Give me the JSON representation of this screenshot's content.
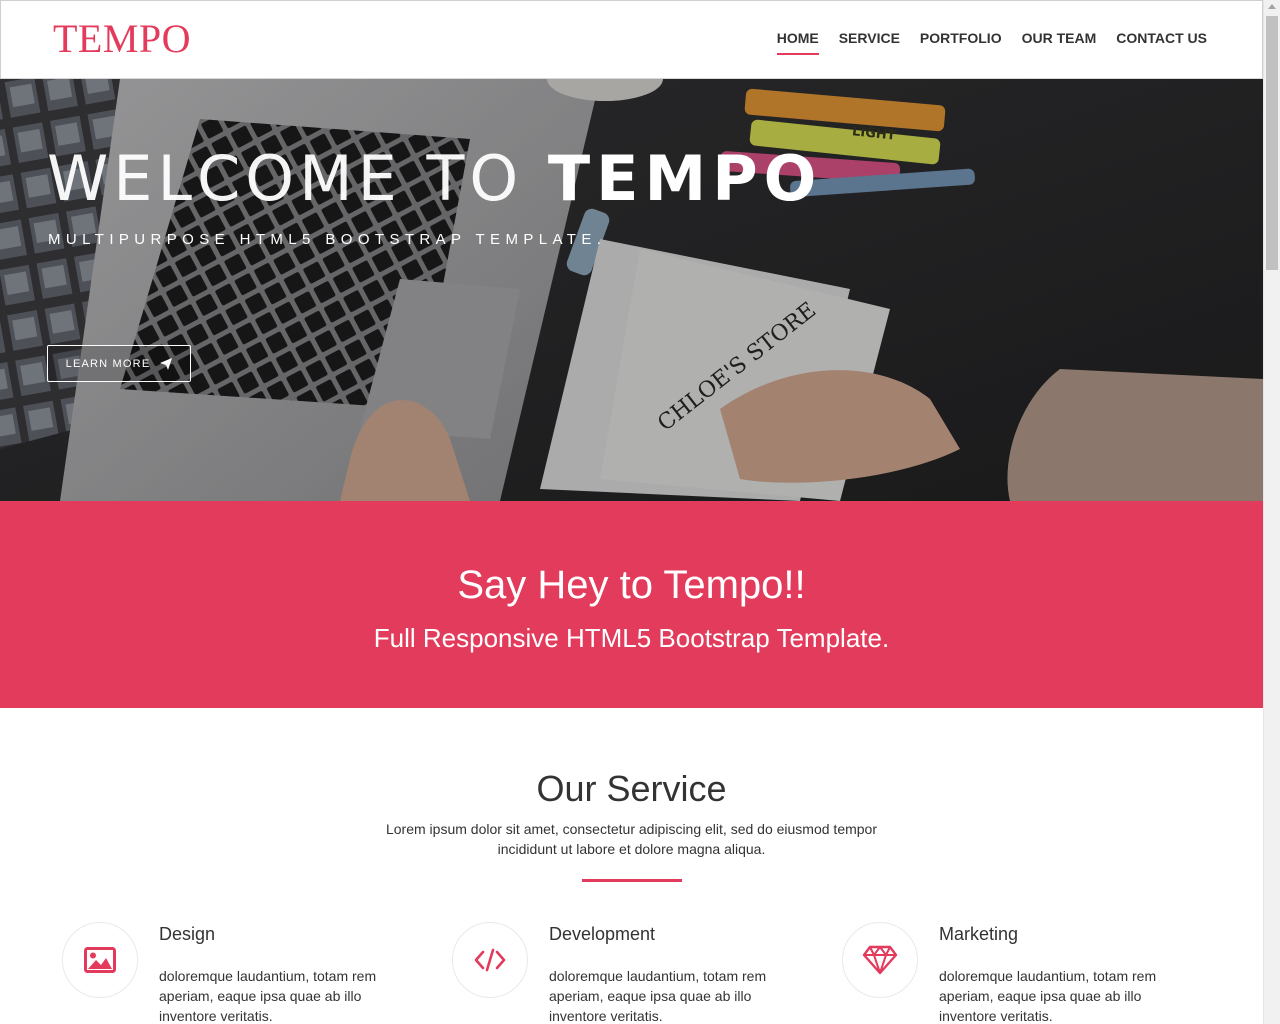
{
  "brand": {
    "logo": "TEMPO",
    "accent_color": "#e33b5b"
  },
  "nav": {
    "items": [
      {
        "label": "HOME",
        "active": true
      },
      {
        "label": "SERVICE",
        "active": false
      },
      {
        "label": "PORTFOLIO",
        "active": false
      },
      {
        "label": "OUR TEAM",
        "active": false
      },
      {
        "label": "CONTACT US",
        "active": false
      }
    ]
  },
  "hero": {
    "title_light": "WELCOME TO ",
    "title_bold": "TEMPO",
    "subtitle": "MULTIPURPOSE HTML5 BOOTSTRAP TEMPLATE.",
    "button_label": "LEARN MORE",
    "button_icon": "paper-plane-icon",
    "photo_text": {
      "marker": "LIGHT",
      "sketch": "CHLOE'S STORE"
    }
  },
  "banner": {
    "heading": "Say Hey to Tempo!!",
    "subheading": "Full Responsive HTML5 Bootstrap Template."
  },
  "service": {
    "heading": "Our Service",
    "intro": "Lorem ipsum dolor sit amet, consectetur adipiscing elit, sed do eiusmod tempor incididunt ut labore et dolore magna aliqua.",
    "items": [
      {
        "icon": "image-icon",
        "title": "Design",
        "text": "doloremque laudantium, totam rem aperiam, eaque ipsa quae ab illo inventore veritatis."
      },
      {
        "icon": "code-icon",
        "title": "Development",
        "text": "doloremque laudantium, totam rem aperiam, eaque ipsa quae ab illo inventore veritatis."
      },
      {
        "icon": "diamond-icon",
        "title": "Marketing",
        "text": "doloremque laudantium, totam rem aperiam, eaque ipsa quae ab illo inventore veritatis."
      }
    ]
  }
}
